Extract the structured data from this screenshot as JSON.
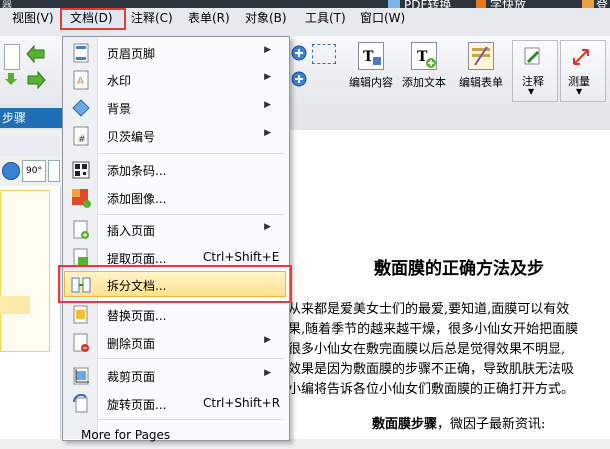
{
  "title_bar": {
    "app_title_fragment": "器",
    "pdf_convert": "PDF转换",
    "shortcut_label": "字快放",
    "login_fragment": "登"
  },
  "menubar": {
    "items": [
      {
        "label": "视图(V)"
      },
      {
        "label": "文档(D)"
      },
      {
        "label": "注释(C)"
      },
      {
        "label": "表单(R)"
      },
      {
        "label": "对象(B)"
      },
      {
        "label": "工具(T)"
      },
      {
        "label": "窗口(W)"
      }
    ]
  },
  "toolbar": {
    "edit_content": "编辑内容",
    "add_text": "添加文本",
    "edit_form": "编辑表单",
    "annotate": "注释",
    "measure": "测量"
  },
  "left": {
    "tab_label": "步骤",
    "rotate_value": "90°"
  },
  "document_menu": {
    "items": [
      {
        "label": "页眉页脚",
        "shortcut": "",
        "icon": "header-footer-icon"
      },
      {
        "label": "水印",
        "shortcut": "",
        "icon": "watermark-icon"
      },
      {
        "label": "背景",
        "shortcut": "",
        "icon": "background-icon"
      },
      {
        "label": "贝茨编号",
        "shortcut": "",
        "icon": "bates-number-icon"
      },
      {
        "label": "添加条码...",
        "shortcut": "",
        "icon": "barcode-icon"
      },
      {
        "label": "添加图像...",
        "shortcut": "",
        "icon": "add-image-icon"
      },
      {
        "label": "插入页面",
        "shortcut": "",
        "icon": "insert-page-icon"
      },
      {
        "label": "提取页面...",
        "shortcut": "Ctrl+Shift+E",
        "icon": "extract-page-icon"
      },
      {
        "label": "拆分文档...",
        "shortcut": "",
        "icon": "split-document-icon"
      },
      {
        "label": "替换页面...",
        "shortcut": "",
        "icon": "replace-page-icon"
      },
      {
        "label": "删除页面",
        "shortcut": "",
        "icon": "delete-page-icon"
      },
      {
        "label": "裁剪页面",
        "shortcut": "",
        "icon": "crop-page-icon"
      },
      {
        "label": "旋转页面...",
        "shortcut": "Ctrl+Shift+R",
        "icon": "rotate-page-icon"
      },
      {
        "label": "More for Pages",
        "shortcut": "",
        "icon": ""
      }
    ]
  },
  "document": {
    "title": "敷面膜的正确方法及步",
    "lines": [
      "从来都是爱美女士们的最爱,要知道,面膜可以有效",
      "果,随着季节的越来越干燥，很多小仙女开始把面膜",
      "很多小仙女在敷完面膜以后总是觉得效果不明显,",
      "效果是因为敷面膜的步骤不正确，导致肌肤无法吸",
      "小编将告诉各位小仙女们敷面膜的正确打开方式。"
    ],
    "sub_heading_bold": "敷面膜步骤",
    "sub_heading_rest": "，微因子最新资讯:"
  },
  "colors": {
    "highlight_border": "#e83a3a",
    "menu_hover": "#ffe28c",
    "tab_blue": "#1f6fb8"
  }
}
